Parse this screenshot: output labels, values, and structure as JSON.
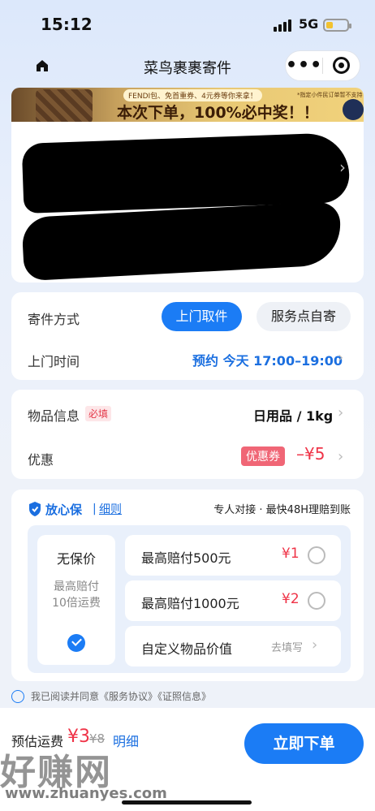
{
  "status_bar": {
    "time": "15:12",
    "network": "5G"
  },
  "nav": {
    "title": "菜鸟裹裹寄件"
  },
  "banner": {
    "subtitle": "FENDI包、免首重券、4元券等你来拿！",
    "headline": "本次下单，100%必中奖！！",
    "note": "*指定小件民订单暂不支持"
  },
  "ship_method": {
    "label": "寄件方式",
    "options": [
      "上门取件",
      "服务点自寄"
    ],
    "selected": "上门取件"
  },
  "pickup_time": {
    "label": "上门时间",
    "value": "预约 今天 17:00–19:00"
  },
  "goods": {
    "label": "物品信息",
    "required_tag": "必填",
    "value": "日用品 / 1kg"
  },
  "discount": {
    "label": "优惠",
    "coupon_tag": "优惠券",
    "amount": "–¥5"
  },
  "insurance": {
    "brand": "放心保",
    "separator": "|",
    "detail_link": "细则",
    "tagline": "专人对接 · 最快48H理赔到账",
    "no_insurance": {
      "title": "无保价",
      "desc_line1": "最高赔付",
      "desc_line2": "10倍运费",
      "selected": true
    },
    "options": [
      {
        "label": "最高赔付500元",
        "price": "¥1"
      },
      {
        "label": "最高赔付1000元",
        "price": "¥2"
      }
    ],
    "custom": {
      "label": "自定义物品价值",
      "hint": "去填写"
    }
  },
  "agreement": {
    "text": "我已阅读并同意《服务协议》《证照信息》"
  },
  "footer": {
    "fee_label": "预估运费",
    "price": "¥3",
    "original_price": "¥8",
    "detail_link": "明细",
    "submit_label": "立即下单"
  },
  "watermark": {
    "text": "好赚网",
    "url": "www.zhuanyes.com"
  },
  "colors": {
    "accent": "#1b7cf5",
    "price_red": "#ef3347",
    "background": "#e8effb"
  }
}
